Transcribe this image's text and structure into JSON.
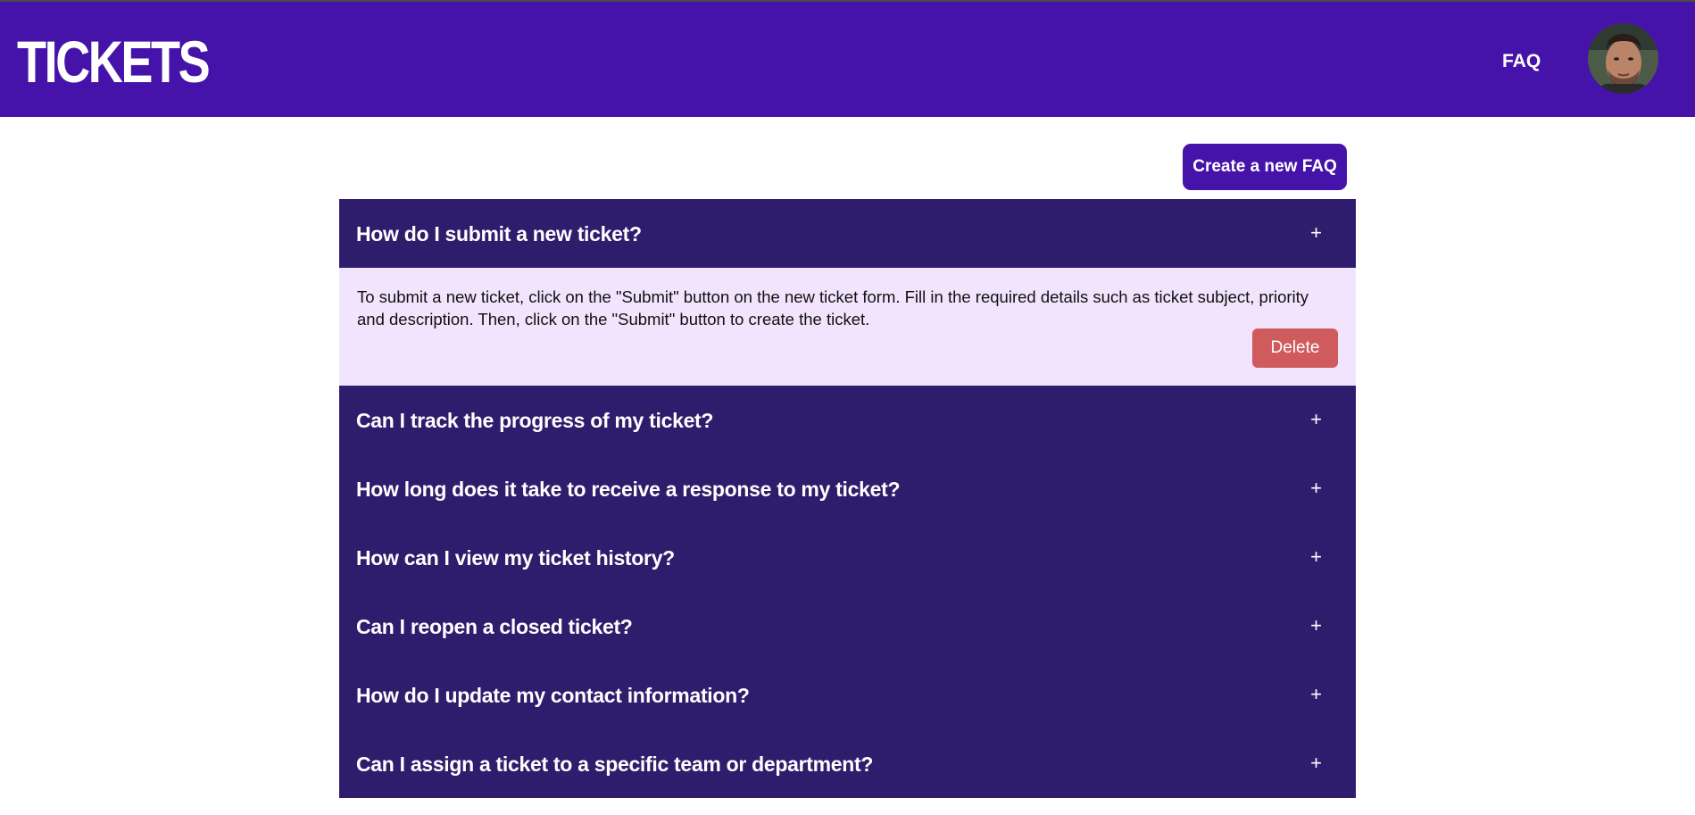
{
  "header": {
    "logo": "TICKETS",
    "nav_faq": "FAQ",
    "avatar_alt": "user avatar"
  },
  "actions": {
    "create_faq_label": "Create a new FAQ"
  },
  "faqs": [
    {
      "question": "How do I submit a new ticket?",
      "toggle": "+",
      "expanded": true,
      "answer": "To submit a new ticket, click on the \"Submit\" button on the new ticket form. Fill in the required details such as ticket subject, priority and description. Then, click on the \"Submit\" button to create the ticket.",
      "delete_label": "Delete"
    },
    {
      "question": "Can I track the progress of my ticket?",
      "toggle": "+",
      "expanded": false
    },
    {
      "question": "How long does it take to receive a response to my ticket?",
      "toggle": "+",
      "expanded": false
    },
    {
      "question": "How can I view my ticket history?",
      "toggle": "+",
      "expanded": false
    },
    {
      "question": "Can I reopen a closed ticket?",
      "toggle": "+",
      "expanded": false
    },
    {
      "question": "How do I update my contact information?",
      "toggle": "+",
      "expanded": false
    },
    {
      "question": "Can I assign a ticket to a specific team or department?",
      "toggle": "+",
      "expanded": false
    }
  ],
  "colors": {
    "header_bg": "#4513aa",
    "question_bg": "#2d1d6c",
    "answer_bg": "#f2e4fc",
    "delete_bg": "#d05b5d"
  }
}
